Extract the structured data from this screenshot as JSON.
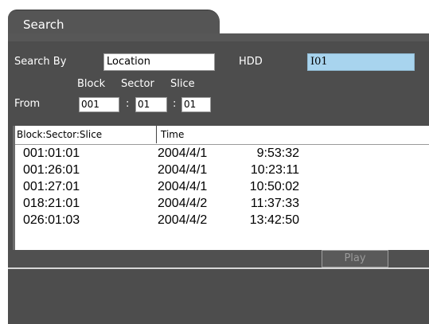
{
  "tab": {
    "label": "Search"
  },
  "search_form": {
    "search_by_label": "Search By",
    "search_by_value": "Location",
    "hdd_label": "HDD",
    "hdd_value": "I01",
    "block_label": "Block",
    "sector_label": "Sector",
    "slice_label": "Slice",
    "from_label": "From",
    "block_value": "001",
    "sector_value": "01",
    "slice_value": "01",
    "colon": ":"
  },
  "results": {
    "columns": [
      "Block:Sector:Slice",
      "Time"
    ],
    "rows": [
      {
        "bss": "001:01:01",
        "date": "2004/4/1",
        "time": "9:53:32"
      },
      {
        "bss": "001:26:01",
        "date": "2004/4/1",
        "time": "10:23:11"
      },
      {
        "bss": "001:27:01",
        "date": "2004/4/1",
        "time": "10:50:02"
      },
      {
        "bss": "018:21:01",
        "date": "2004/4/2",
        "time": "11:37:33"
      },
      {
        "bss": "026:01:03",
        "date": "2004/4/2",
        "time": "13:42:50"
      }
    ]
  },
  "actions": {
    "play_label": "Play"
  }
}
